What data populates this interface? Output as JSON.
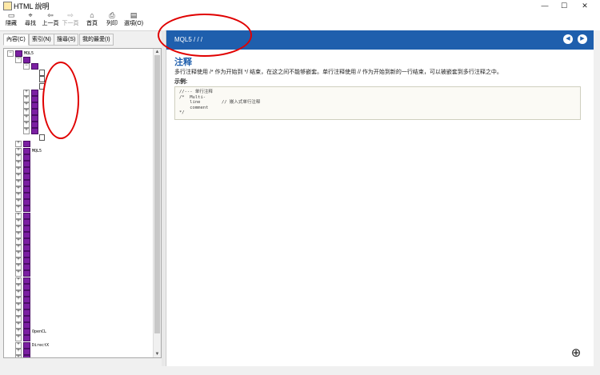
{
  "window": {
    "title": "HTML 說明",
    "buttons": [
      "—",
      "☐",
      "✕"
    ]
  },
  "toolbar": [
    {
      "icon": "hide-icon",
      "glyph": "▭",
      "label": "隱藏",
      "enabled": true
    },
    {
      "icon": "locate-icon",
      "glyph": "⌖",
      "label": "尋找",
      "enabled": true
    },
    {
      "icon": "back-icon",
      "glyph": "⇦",
      "label": "上一頁",
      "enabled": true
    },
    {
      "icon": "forward-icon",
      "glyph": "⇨",
      "label": "下一頁",
      "enabled": false
    },
    {
      "icon": "home-icon",
      "glyph": "⌂",
      "label": "首頁",
      "enabled": true
    },
    {
      "icon": "print-icon",
      "glyph": "⎙",
      "label": "列印",
      "enabled": true
    },
    {
      "icon": "options-icon",
      "glyph": "▤",
      "label": "選項(O)",
      "enabled": true
    }
  ],
  "tabs": [
    {
      "label": "內容(C)",
      "active": true
    },
    {
      "label": "索引(N)",
      "active": false
    },
    {
      "label": "搜尋(S)",
      "active": false
    },
    {
      "label": "我的最愛(I)",
      "active": false
    }
  ],
  "tree": {
    "rows": [
      {
        "depth": 0,
        "type": "book",
        "label": "MQL5",
        "exp": "−"
      },
      {
        "depth": 1,
        "type": "book",
        "label": "",
        "exp": "−"
      },
      {
        "depth": 2,
        "type": "book",
        "label": "",
        "exp": "−"
      },
      {
        "depth": 3,
        "type": "page",
        "label": "",
        "exp": ""
      },
      {
        "depth": 3,
        "type": "page",
        "label": "",
        "exp": ""
      },
      {
        "depth": 3,
        "type": "page",
        "label": "",
        "exp": ""
      },
      {
        "depth": 2,
        "type": "book",
        "label": "",
        "exp": "+"
      },
      {
        "depth": 2,
        "type": "book",
        "label": "",
        "exp": "+"
      },
      {
        "depth": 2,
        "type": "book",
        "label": "",
        "exp": "+"
      },
      {
        "depth": 2,
        "type": "book",
        "label": "",
        "exp": "+"
      },
      {
        "depth": 2,
        "type": "book",
        "label": "",
        "exp": "+"
      },
      {
        "depth": 2,
        "type": "book",
        "label": "",
        "exp": "+"
      },
      {
        "depth": 2,
        "type": "book",
        "label": "",
        "exp": "+"
      },
      {
        "depth": 3,
        "type": "page",
        "label": "",
        "exp": ""
      },
      {
        "depth": 1,
        "type": "book",
        "label": "",
        "exp": "+"
      },
      {
        "depth": 1,
        "type": "book",
        "label": "MQL5",
        "exp": "+"
      },
      {
        "depth": 1,
        "type": "book",
        "label": "",
        "exp": "+"
      },
      {
        "depth": 1,
        "type": "book",
        "label": "",
        "exp": "+"
      },
      {
        "depth": 1,
        "type": "book",
        "label": "",
        "exp": "+"
      },
      {
        "depth": 1,
        "type": "book",
        "label": "",
        "exp": "+"
      },
      {
        "depth": 1,
        "type": "book",
        "label": "",
        "exp": "+"
      },
      {
        "depth": 1,
        "type": "book",
        "label": "",
        "exp": "+"
      },
      {
        "depth": 1,
        "type": "book",
        "label": "",
        "exp": "+"
      },
      {
        "depth": 1,
        "type": "book",
        "label": "",
        "exp": "+"
      },
      {
        "depth": 1,
        "type": "book",
        "label": "",
        "exp": "+"
      },
      {
        "depth": 1,
        "type": "book",
        "label": "",
        "exp": "+"
      },
      {
        "depth": 1,
        "type": "book",
        "label": "",
        "exp": "+"
      },
      {
        "depth": 1,
        "type": "book",
        "label": "",
        "exp": "+"
      },
      {
        "depth": 1,
        "type": "book",
        "label": "",
        "exp": "+"
      },
      {
        "depth": 1,
        "type": "book",
        "label": "",
        "exp": "+"
      },
      {
        "depth": 1,
        "type": "book",
        "label": "",
        "exp": "+"
      },
      {
        "depth": 1,
        "type": "book",
        "label": "",
        "exp": "+"
      },
      {
        "depth": 1,
        "type": "book",
        "label": "",
        "exp": "+"
      },
      {
        "depth": 1,
        "type": "book",
        "label": "",
        "exp": "+"
      },
      {
        "depth": 1,
        "type": "book",
        "label": "",
        "exp": "+"
      },
      {
        "depth": 1,
        "type": "book",
        "label": "",
        "exp": "+"
      },
      {
        "depth": 1,
        "type": "book",
        "label": "",
        "exp": "+"
      },
      {
        "depth": 1,
        "type": "book",
        "label": "",
        "exp": "+"
      },
      {
        "depth": 1,
        "type": "book",
        "label": "",
        "exp": "+"
      },
      {
        "depth": 1,
        "type": "book",
        "label": "",
        "exp": "+"
      },
      {
        "depth": 1,
        "type": "book",
        "label": "",
        "exp": "+"
      },
      {
        "depth": 1,
        "type": "book",
        "label": "",
        "exp": "+"
      },
      {
        "depth": 1,
        "type": "book",
        "label": "",
        "exp": "+"
      },
      {
        "depth": 1,
        "type": "book",
        "label": "OpenCL",
        "exp": "+"
      },
      {
        "depth": 1,
        "type": "book",
        "label": "",
        "exp": "+"
      },
      {
        "depth": 1,
        "type": "book",
        "label": "DirectX",
        "exp": "+"
      },
      {
        "depth": 1,
        "type": "book",
        "label": "",
        "exp": "+"
      },
      {
        "depth": 1,
        "type": "book",
        "label": "",
        "exp": "+"
      }
    ]
  },
  "content": {
    "breadcrumb": "MQL5 /  /  /",
    "nav_prev": "◀",
    "nav_next": "▶",
    "heading": "注释",
    "paragraph": "多行注释使用 /* 作为开始到 */ 结束，在这之间不能够嵌套。单行注释使用 // 作为开始到新的一行结束，可以被嵌套到多行注释之中。",
    "example_label": "示例:",
    "code": "//--- 单行注释\n/*  Multi-\n    line        // 嵌入式单行注释\n    comment\n*/"
  },
  "colors": {
    "banner": "#1f5fad",
    "heading": "#1f5fad",
    "annotation": "#e00000",
    "book_icon": "#7b1fa2"
  },
  "icons": {
    "magnify": "magnify-icon"
  }
}
